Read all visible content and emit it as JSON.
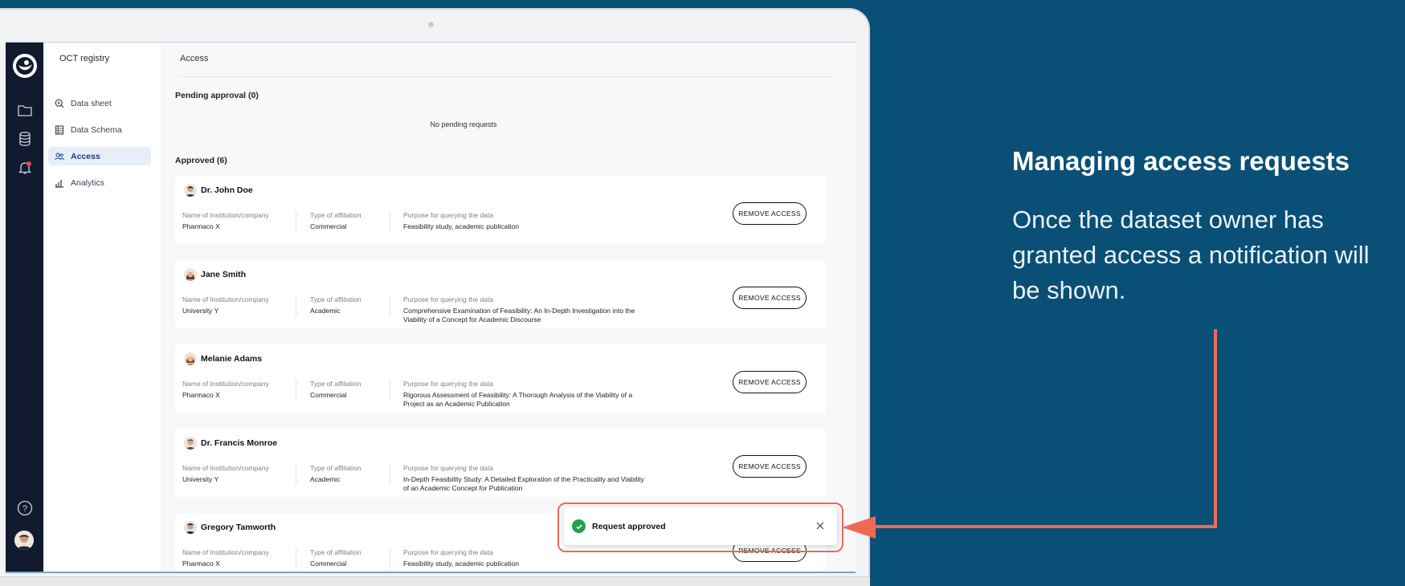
{
  "app": {
    "title": "OCT registry"
  },
  "sidebar": {
    "items": [
      {
        "label": "Data sheet",
        "icon": "search-data-icon"
      },
      {
        "label": "Data Schema",
        "icon": "table-icon"
      },
      {
        "label": "Access",
        "icon": "users-icon",
        "active": true
      },
      {
        "label": "Analytics",
        "icon": "bar-chart-icon"
      }
    ]
  },
  "rail": {
    "icons": [
      "logo-icon",
      "folder-icon",
      "database-icon",
      "bell-icon",
      "help-icon",
      "avatar"
    ]
  },
  "main": {
    "breadcrumb": "Access",
    "pending_title": "Pending approval (0)",
    "pending_empty": "No pending requests",
    "approved_title": "Approved (6)",
    "field_labels": {
      "institution": "Name of Institution/company",
      "affiliation": "Type of affiliation",
      "purpose": "Purpose for querying the data"
    },
    "remove_label": "REMOVE ACCESS",
    "cards": [
      {
        "name": "Dr. John Doe",
        "institution": "Pharmaco X",
        "affiliation": "Commercial",
        "purpose": "Feasibility study, academic publication"
      },
      {
        "name": "Jane Smith",
        "institution": "University Y",
        "affiliation": "Academic",
        "purpose": "Comprehensive Examination of Feasibility: An In-Depth Investigation into the Viability of a Concept for Academic Discourse"
      },
      {
        "name": "Melanie Adams",
        "institution": "Pharmaco X",
        "affiliation": "Commercial",
        "purpose": "Rigorous Assessment of Feasibility: A Thorough Analysis of the Viability of a Project as an Academic Publication"
      },
      {
        "name": "Dr. Francis Monroe",
        "institution": "University Y",
        "affiliation": "Academic",
        "purpose": "In-Depth Feasibility Study: A Detailed Exploration of the Practicality and Viability of an Academic Concept for Publication"
      },
      {
        "name": "Gregory Tamworth",
        "institution": "Pharmaco X",
        "affiliation": "Commercial",
        "purpose": "Feasibility study, academic publication"
      }
    ]
  },
  "toast": {
    "message": "Request approved"
  },
  "callout": {
    "headline": "Managing access requests",
    "description": "Once the dataset owner has granted access a notification will be shown.",
    "accent_color": "#ef6a55"
  },
  "colors": {
    "background": "#0a4f75",
    "rail": "#111a2e",
    "success": "#22a24a"
  }
}
